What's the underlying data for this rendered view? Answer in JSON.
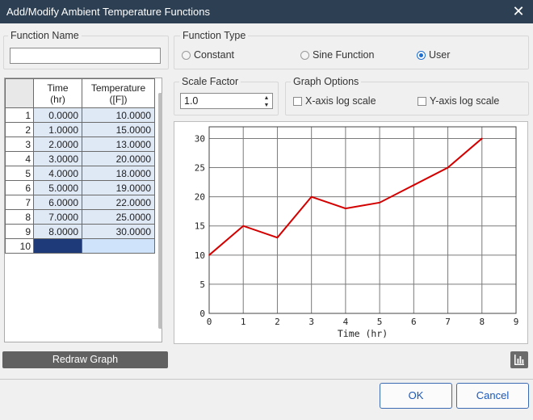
{
  "window": {
    "title": "Add/Modify Ambient Temperature Functions",
    "close": "✕"
  },
  "function_name": {
    "label": "Function Name",
    "value": ""
  },
  "function_type": {
    "label": "Function Type",
    "options": [
      {
        "label": "Constant",
        "selected": false
      },
      {
        "label": "Sine Function",
        "selected": false
      },
      {
        "label": "User",
        "selected": true
      }
    ]
  },
  "scale_factor": {
    "label": "Scale Factor",
    "value": "1.0"
  },
  "graph_options": {
    "label": "Graph Options",
    "x_log": {
      "label": "X-axis log scale",
      "checked": false
    },
    "y_log": {
      "label": "Y-axis log scale",
      "checked": false
    }
  },
  "table": {
    "headers": {
      "time": "Time\n(hr)",
      "temp": "Temperature\n([F])"
    },
    "rows": [
      {
        "n": "1",
        "time": "0.0000",
        "temp": "10.0000"
      },
      {
        "n": "2",
        "time": "1.0000",
        "temp": "15.0000"
      },
      {
        "n": "3",
        "time": "2.0000",
        "temp": "13.0000"
      },
      {
        "n": "4",
        "time": "3.0000",
        "temp": "20.0000"
      },
      {
        "n": "5",
        "time": "4.0000",
        "temp": "18.0000"
      },
      {
        "n": "6",
        "time": "5.0000",
        "temp": "19.0000"
      },
      {
        "n": "7",
        "time": "6.0000",
        "temp": "22.0000"
      },
      {
        "n": "8",
        "time": "7.0000",
        "temp": "25.0000"
      },
      {
        "n": "9",
        "time": "8.0000",
        "temp": "30.0000"
      }
    ],
    "new_row": "10"
  },
  "buttons": {
    "redraw": "Redraw Graph",
    "ok": "OK",
    "cancel": "Cancel",
    "chart_icon": "bar-chart-icon"
  },
  "colors": {
    "line": "#d40000",
    "titlebar": "#2d3f52"
  },
  "chart_data": {
    "type": "line",
    "title": "",
    "xlabel": "Time (hr)",
    "ylabel": "",
    "xlim": [
      0,
      9
    ],
    "ylim": [
      0,
      32
    ],
    "xticks": [
      0,
      1,
      2,
      3,
      4,
      5,
      6,
      7,
      8,
      9
    ],
    "yticks": [
      0,
      5,
      10,
      15,
      20,
      25,
      30
    ],
    "grid": true,
    "series": [
      {
        "x": [
          0,
          1,
          2,
          3,
          4,
          5,
          6,
          7,
          8
        ],
        "values": [
          10,
          15,
          13,
          20,
          18,
          19,
          22,
          25,
          30
        ]
      }
    ]
  }
}
